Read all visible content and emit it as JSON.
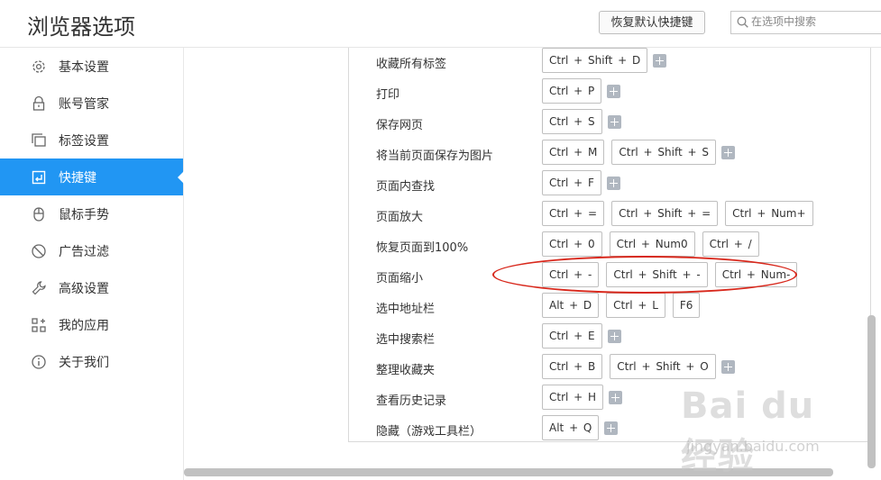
{
  "header": {
    "title": "浏览器选项",
    "restore_button": "恢复默认快捷键",
    "search_placeholder": "在选项中搜索"
  },
  "sidebar": {
    "items": [
      {
        "label": "基本设置",
        "icon": "gear-icon"
      },
      {
        "label": "账号管家",
        "icon": "lock-icon"
      },
      {
        "label": "标签设置",
        "icon": "tabs-icon"
      },
      {
        "label": "快捷键",
        "icon": "shortcut-icon",
        "active": true
      },
      {
        "label": "鼠标手势",
        "icon": "mouse-icon"
      },
      {
        "label": "广告过滤",
        "icon": "block-icon"
      },
      {
        "label": "高级设置",
        "icon": "wrench-icon"
      },
      {
        "label": "我的应用",
        "icon": "apps-icon"
      },
      {
        "label": "关于我们",
        "icon": "info-icon"
      }
    ]
  },
  "shortcuts": [
    {
      "action": "收藏所有标签",
      "keys": [
        "Ctrl + Shift + D"
      ],
      "add": true
    },
    {
      "action": "打印",
      "keys": [
        "Ctrl + P"
      ],
      "add": true
    },
    {
      "action": "保存网页",
      "keys": [
        "Ctrl + S"
      ],
      "add": true
    },
    {
      "action": "将当前页面保存为图片",
      "keys": [
        "Ctrl + M",
        "Ctrl + Shift + S"
      ],
      "add": true
    },
    {
      "action": "页面内查找",
      "keys": [
        "Ctrl + F"
      ],
      "add": true
    },
    {
      "action": "页面放大",
      "keys": [
        "Ctrl + =",
        "Ctrl + Shift + =",
        "Ctrl + Num+"
      ],
      "add": false
    },
    {
      "action": "恢复页面到100%",
      "keys": [
        "Ctrl + 0",
        "Ctrl + Num0",
        "Ctrl + /"
      ],
      "add": false
    },
    {
      "action": "页面缩小",
      "keys": [
        "Ctrl + -",
        "Ctrl + Shift + -",
        "Ctrl + Num-"
      ],
      "add": false
    },
    {
      "action": "选中地址栏",
      "keys": [
        "Alt + D",
        "Ctrl + L",
        "F6"
      ],
      "add": false
    },
    {
      "action": "选中搜索栏",
      "keys": [
        "Ctrl + E"
      ],
      "add": true
    },
    {
      "action": "整理收藏夹",
      "keys": [
        "Ctrl + B",
        "Ctrl + Shift + O"
      ],
      "add": true
    },
    {
      "action": "查看历史记录",
      "keys": [
        "Ctrl + H"
      ],
      "add": true
    },
    {
      "action": "隐藏（游戏工具栏）",
      "keys": [
        "Alt + Q"
      ],
      "add": true
    }
  ],
  "colors": {
    "accent": "#2196f3",
    "annotation": "#d8281c"
  },
  "watermark": {
    "logo": "Bai du 经验",
    "url": "jingyan.baidu.com"
  }
}
